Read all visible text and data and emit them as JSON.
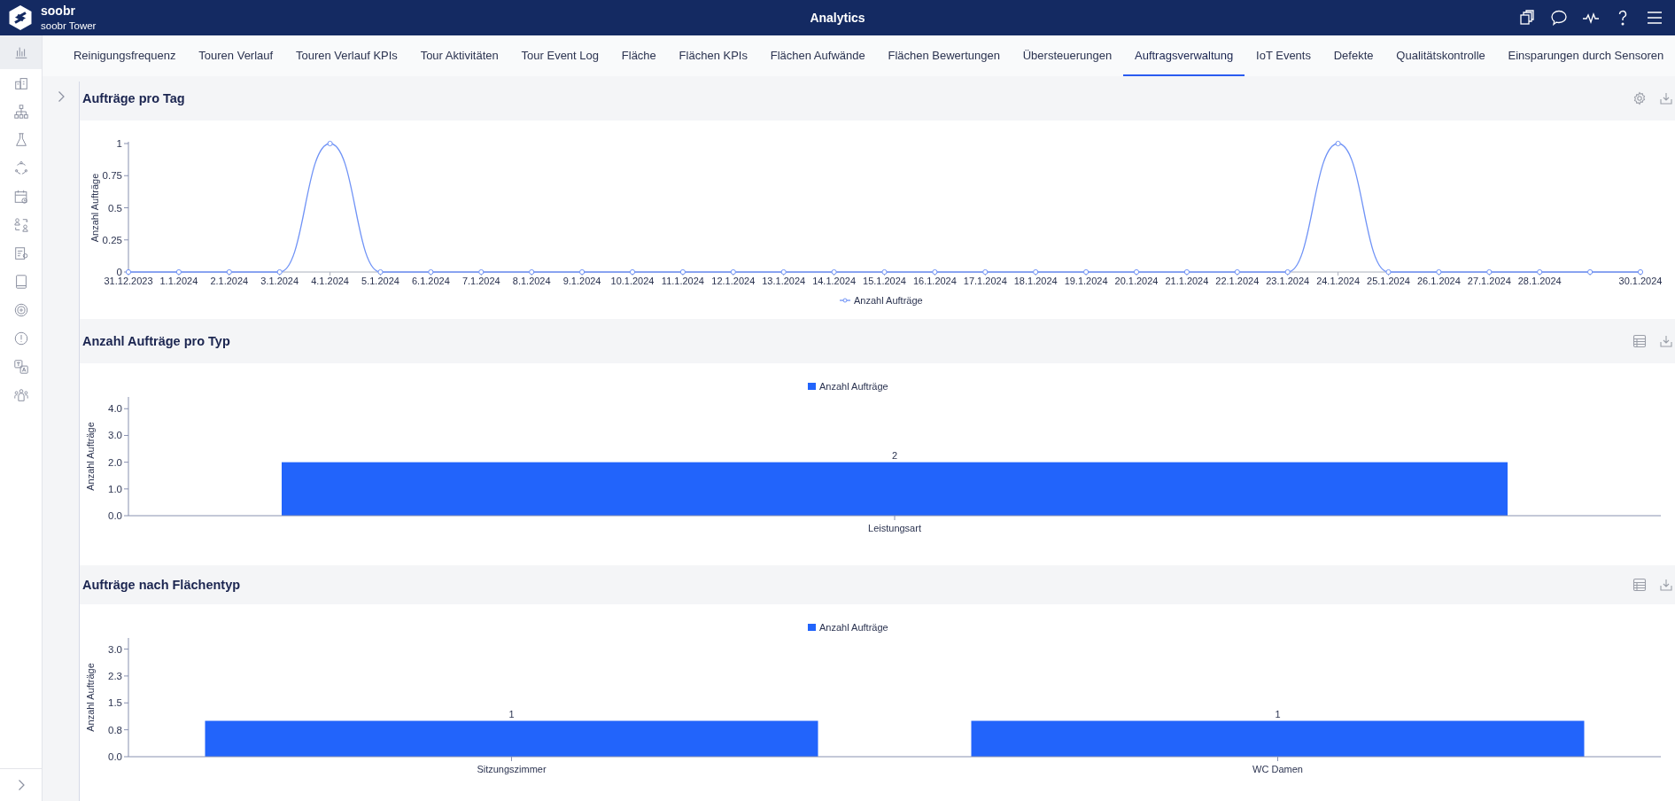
{
  "header": {
    "brand": "soobr",
    "subtitle": "soobr Tower",
    "title": "Analytics"
  },
  "sidebar": {
    "items": [
      {
        "selected": true
      },
      {
        "selected": false
      },
      {
        "selected": false
      },
      {
        "selected": false
      },
      {
        "selected": false
      },
      {
        "selected": false
      },
      {
        "selected": false
      },
      {
        "selected": false
      },
      {
        "selected": false
      },
      {
        "selected": false
      },
      {
        "selected": false
      },
      {
        "selected": false
      },
      {
        "selected": false
      }
    ]
  },
  "tabs": [
    {
      "label": "Reinigungsfrequenz",
      "selected": false
    },
    {
      "label": "Touren Verlauf",
      "selected": false
    },
    {
      "label": "Touren Verlauf KPIs",
      "selected": false
    },
    {
      "label": "Tour Aktivitäten",
      "selected": false
    },
    {
      "label": "Tour Event Log",
      "selected": false
    },
    {
      "label": "Fläche",
      "selected": false
    },
    {
      "label": "Flächen KPIs",
      "selected": false
    },
    {
      "label": "Flächen Aufwände",
      "selected": false
    },
    {
      "label": "Flächen Bewertungen",
      "selected": false
    },
    {
      "label": "Übersteuerungen",
      "selected": false
    },
    {
      "label": "Auftragsverwaltung",
      "selected": true
    },
    {
      "label": "IoT Events",
      "selected": false
    },
    {
      "label": "Defekte",
      "selected": false
    },
    {
      "label": "Qualitätskontrolle",
      "selected": false
    },
    {
      "label": "Einsparungen durch Sensoren",
      "selected": false
    }
  ],
  "sections": [
    {
      "title": "Aufträge pro Tag",
      "chart_data": {
        "type": "line",
        "ylabel": "Anzahl Aufträge",
        "categories": [
          "31.12.2023",
          "1.1.2024",
          "2.1.2024",
          "3.1.2024",
          "4.1.2024",
          "5.1.2024",
          "6.1.2024",
          "7.1.2024",
          "8.1.2024",
          "9.1.2024",
          "10.1.2024",
          "11.1.2024",
          "12.1.2024",
          "13.1.2024",
          "14.1.2024",
          "15.1.2024",
          "16.1.2024",
          "17.1.2024",
          "18.1.2024",
          "19.1.2024",
          "20.1.2024",
          "21.1.2024",
          "22.1.2024",
          "23.1.2024",
          "24.1.2024",
          "25.1.2024",
          "26.1.2024",
          "27.1.2024",
          "28.1.2024",
          null,
          "30.1.2024"
        ],
        "ylim": [
          0,
          1
        ],
        "series": [
          {
            "name": "Anzahl Aufträge",
            "color": "#7093f6",
            "marker": "circle",
            "values": [
              0,
              0,
              0,
              0,
              1,
              0,
              0,
              0,
              0,
              0,
              0,
              0,
              0,
              0,
              0,
              0,
              0,
              0,
              0,
              0,
              0,
              0,
              0,
              0,
              1,
              0,
              0,
              0,
              0,
              0,
              0
            ]
          }
        ],
        "yticks": [
          0,
          0.25,
          0.5,
          0.75,
          1
        ]
      }
    },
    {
      "title": "Anzahl Aufträge pro Typ",
      "chart_data": {
        "type": "bar",
        "ylabel": "Anzahl Aufträge",
        "categories": [
          "Leistungsart"
        ],
        "ylim": [
          0,
          4.44
        ],
        "series": [
          {
            "name": "Anzahl Aufträge",
            "color": "#2264fb",
            "values": [
              2
            ]
          }
        ],
        "yticks": [
          {
            "value": 0,
            "label": "0.0"
          },
          {
            "value": 1,
            "label": "1.0"
          },
          {
            "value": 2,
            "label": "2.0"
          },
          {
            "value": 3,
            "label": "3.0"
          },
          {
            "value": 4,
            "label": "4.0"
          }
        ],
        "data_labels": true
      }
    },
    {
      "title": "Aufträge nach Flächentyp",
      "chart_data": {
        "type": "bar",
        "ylabel": "Anzahl Aufträge",
        "categories": [
          "Sitzungszimmer",
          "WC Damen"
        ],
        "ylim": [
          0,
          3.31
        ],
        "series": [
          {
            "name": "Anzahl Aufträge",
            "color": "#2264fb",
            "values": [
              1,
              1
            ]
          }
        ],
        "yticks": [
          {
            "value": 0,
            "label": "0.0"
          },
          {
            "value": 0.75,
            "label": "0.8"
          },
          {
            "value": 1.5,
            "label": "1.5"
          },
          {
            "value": 2.25,
            "label": "2.3"
          },
          {
            "value": 3,
            "label": "3.0"
          }
        ],
        "data_labels": true
      }
    }
  ]
}
